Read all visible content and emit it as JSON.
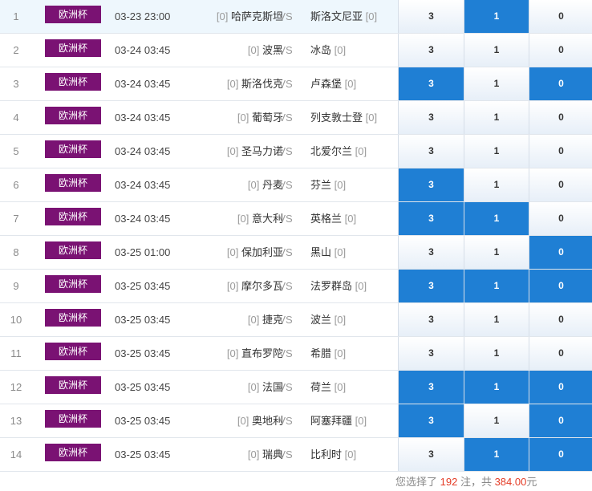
{
  "matches": [
    {
      "idx": "1",
      "league": "欧洲杯",
      "time": "03-23 23:00",
      "home_bracket": "[0]",
      "home": "哈萨克斯坦",
      "vs": "VS",
      "away": "斯洛文尼亚",
      "away_bracket": "[0]",
      "o3": "3",
      "o1": "1",
      "o0": "0",
      "sel": [
        false,
        true,
        false
      ]
    },
    {
      "idx": "2",
      "league": "欧洲杯",
      "time": "03-24 03:45",
      "home_bracket": "[0]",
      "home": "波黑",
      "vs": "VS",
      "away": "冰岛",
      "away_bracket": "[0]",
      "o3": "3",
      "o1": "1",
      "o0": "0",
      "sel": [
        false,
        false,
        false
      ]
    },
    {
      "idx": "3",
      "league": "欧洲杯",
      "time": "03-24 03:45",
      "home_bracket": "[0]",
      "home": "斯洛伐克",
      "vs": "VS",
      "away": "卢森堡",
      "away_bracket": "[0]",
      "o3": "3",
      "o1": "1",
      "o0": "0",
      "sel": [
        true,
        false,
        true
      ]
    },
    {
      "idx": "4",
      "league": "欧洲杯",
      "time": "03-24 03:45",
      "home_bracket": "[0]",
      "home": "葡萄牙",
      "vs": "VS",
      "away": "列支敦士登",
      "away_bracket": "[0]",
      "o3": "3",
      "o1": "1",
      "o0": "0",
      "sel": [
        false,
        false,
        false
      ]
    },
    {
      "idx": "5",
      "league": "欧洲杯",
      "time": "03-24 03:45",
      "home_bracket": "[0]",
      "home": "圣马力诺",
      "vs": "VS",
      "away": "北爱尔兰",
      "away_bracket": "[0]",
      "o3": "3",
      "o1": "1",
      "o0": "0",
      "sel": [
        false,
        false,
        false
      ]
    },
    {
      "idx": "6",
      "league": "欧洲杯",
      "time": "03-24 03:45",
      "home_bracket": "[0]",
      "home": "丹麦",
      "vs": "VS",
      "away": "芬兰",
      "away_bracket": "[0]",
      "o3": "3",
      "o1": "1",
      "o0": "0",
      "sel": [
        true,
        false,
        false
      ]
    },
    {
      "idx": "7",
      "league": "欧洲杯",
      "time": "03-24 03:45",
      "home_bracket": "[0]",
      "home": "意大利",
      "vs": "VS",
      "away": "英格兰",
      "away_bracket": "[0]",
      "o3": "3",
      "o1": "1",
      "o0": "0",
      "sel": [
        true,
        true,
        false
      ]
    },
    {
      "idx": "8",
      "league": "欧洲杯",
      "time": "03-25 01:00",
      "home_bracket": "[0]",
      "home": "保加利亚",
      "vs": "VS",
      "away": "黑山",
      "away_bracket": "[0]",
      "o3": "3",
      "o1": "1",
      "o0": "0",
      "sel": [
        false,
        false,
        true
      ]
    },
    {
      "idx": "9",
      "league": "欧洲杯",
      "time": "03-25 03:45",
      "home_bracket": "[0]",
      "home": "摩尔多瓦",
      "vs": "VS",
      "away": "法罗群岛",
      "away_bracket": "[0]",
      "o3": "3",
      "o1": "1",
      "o0": "0",
      "sel": [
        true,
        true,
        true
      ]
    },
    {
      "idx": "10",
      "league": "欧洲杯",
      "time": "03-25 03:45",
      "home_bracket": "[0]",
      "home": "捷克",
      "vs": "VS",
      "away": "波兰",
      "away_bracket": "[0]",
      "o3": "3",
      "o1": "1",
      "o0": "0",
      "sel": [
        false,
        false,
        false
      ]
    },
    {
      "idx": "11",
      "league": "欧洲杯",
      "time": "03-25 03:45",
      "home_bracket": "[0]",
      "home": "直布罗陀",
      "vs": "VS",
      "away": "希腊",
      "away_bracket": "[0]",
      "o3": "3",
      "o1": "1",
      "o0": "0",
      "sel": [
        false,
        false,
        false
      ]
    },
    {
      "idx": "12",
      "league": "欧洲杯",
      "time": "03-25 03:45",
      "home_bracket": "[0]",
      "home": "法国",
      "vs": "VS",
      "away": "荷兰",
      "away_bracket": "[0]",
      "o3": "3",
      "o1": "1",
      "o0": "0",
      "sel": [
        true,
        true,
        true
      ]
    },
    {
      "idx": "13",
      "league": "欧洲杯",
      "time": "03-25 03:45",
      "home_bracket": "[0]",
      "home": "奥地利",
      "vs": "VS",
      "away": "阿塞拜疆",
      "away_bracket": "[0]",
      "o3": "3",
      "o1": "1",
      "o0": "0",
      "sel": [
        true,
        false,
        true
      ]
    },
    {
      "idx": "14",
      "league": "欧洲杯",
      "time": "03-25 03:45",
      "home_bracket": "[0]",
      "home": "瑞典",
      "vs": "VS",
      "away": "比利时",
      "away_bracket": "[0]",
      "o3": "3",
      "o1": "1",
      "o0": "0",
      "sel": [
        false,
        true,
        true
      ]
    }
  ],
  "summary": {
    "prefix": "您选择了 ",
    "count": "192",
    "middle": " 注，共 ",
    "amount": "384.00",
    "suffix": "元"
  },
  "colors": {
    "badge": "#7a1273",
    "selected": "#1f7fd4",
    "highlight": "#e43b25"
  }
}
